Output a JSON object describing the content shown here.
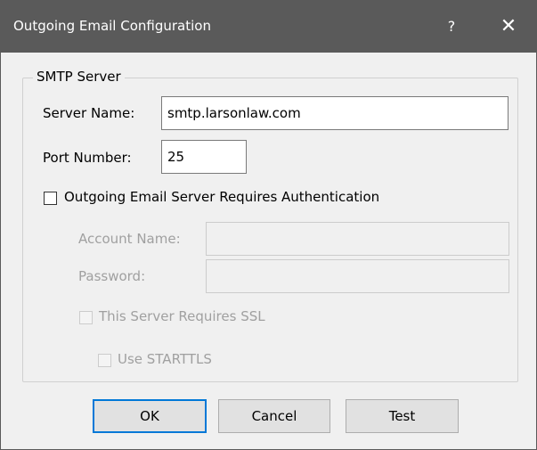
{
  "window": {
    "title": "Outgoing Email Configuration",
    "help_glyph": "?",
    "close_glyph": "✕"
  },
  "smtp_group": {
    "title": "SMTP Server",
    "server_name_label": "Server Name:",
    "server_name_value": "smtp.larsonlaw.com",
    "port_label": "Port Number:",
    "port_value": "25",
    "auth_label": "Outgoing Email Server Requires Authentication",
    "auth_checked": false,
    "account_name_label": "Account Name:",
    "account_name_value": "",
    "password_label": "Password:",
    "password_value": "",
    "ssl_label": "This Server Requires SSL",
    "ssl_checked": false,
    "starttls_label": "Use STARTTLS",
    "starttls_checked": false
  },
  "buttons": {
    "ok": "OK",
    "cancel": "Cancel",
    "test": "Test"
  },
  "colors": {
    "titlebar": "#5a5a5a",
    "dialog_bg": "#f0f0f0",
    "default_button_border": "#0078d7",
    "disabled_text": "#a0a0a0"
  }
}
